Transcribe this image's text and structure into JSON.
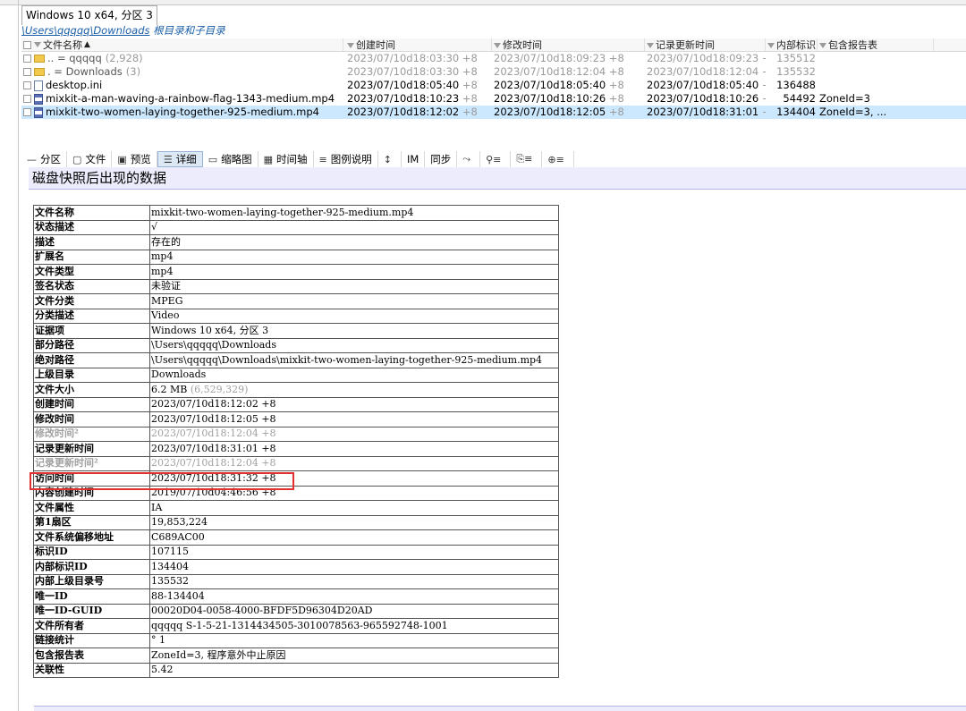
{
  "tab": {
    "label": "Windows 10 x64, 分区 3"
  },
  "path": {
    "main": "\\Users\\qqqqq\\Downloads",
    "suffix": " 根目录和子目录"
  },
  "columns": {
    "name": "文件名称",
    "created": "创建时间",
    "modified": "修改时间",
    "record": "记录更新时间",
    "internal": "内部标识",
    "report": "包含报告表"
  },
  "rows": [
    {
      "icon": "folder",
      "name": "..  =  qqqqq",
      "count": "(2,928)",
      "created": "2023/07/10d18:03:30",
      "modified": "2023/07/10d18:09:23",
      "record": "2023/07/10d18:09:23",
      "internal": "135512",
      "report": "",
      "tz": "+8",
      "dim": true,
      "selected": false
    },
    {
      "icon": "folder",
      "name": ".  =  Downloads",
      "count": "(3)",
      "created": "2023/07/10d18:03:30",
      "modified": "2023/07/10d18:12:04",
      "record": "2023/07/10d18:12:04",
      "internal": "135532",
      "report": "",
      "tz": "+8",
      "dim": true,
      "selected": false
    },
    {
      "icon": "file",
      "name": "desktop.ini",
      "count": "",
      "created": "2023/07/10d18:05:40",
      "modified": "2023/07/10d18:05:40",
      "record": "2023/07/10d18:05:40",
      "internal": "136488",
      "report": "",
      "tz": "+8",
      "dim": false,
      "selected": false
    },
    {
      "icon": "video",
      "name": "mixkit-a-man-waving-a-rainbow-flag-1343-medium.mp4",
      "count": "",
      "created": "2023/07/10d18:10:23",
      "modified": "2023/07/10d18:10:26",
      "record": "2023/07/10d18:10:26",
      "internal": "54492",
      "report": "ZoneId=3",
      "tz": "+8",
      "dim": false,
      "selected": false
    },
    {
      "icon": "video",
      "name": "mixkit-two-women-laying-together-925-medium.mp4",
      "count": "",
      "created": "2023/07/10d18:12:02",
      "modified": "2023/07/10d18:12:05",
      "record": "2023/07/10d18:31:01",
      "internal": "134404",
      "report": "ZoneId=3, ...",
      "tz": "+8",
      "dim": false,
      "selected": true
    }
  ],
  "toolbar": [
    {
      "icon": "minus-icon",
      "glyph": "—",
      "label": "分区"
    },
    {
      "icon": "file-icon",
      "glyph": "▢",
      "label": "文件"
    },
    {
      "icon": "preview-icon",
      "glyph": "▣",
      "label": "预览"
    },
    {
      "icon": "details-icon",
      "glyph": "☰",
      "label": "详细",
      "active": true
    },
    {
      "icon": "thumbnail-icon",
      "glyph": "▭",
      "label": "缩略图"
    },
    {
      "icon": "timeline-icon",
      "glyph": "▦",
      "label": "时间轴"
    },
    {
      "icon": "legend-icon",
      "glyph": "≡",
      "label": "图例说明"
    },
    {
      "icon": "sort-icon",
      "glyph": "↕",
      "label": ""
    },
    {
      "icon": "im-icon",
      "glyph": "",
      "label": "IM"
    },
    {
      "icon": "sync-icon",
      "glyph": "",
      "label": "同步"
    },
    {
      "icon": "link-icon",
      "glyph": "⤳",
      "label": ""
    },
    {
      "icon": "binoculars-icon",
      "glyph": "⚲≡",
      "label": ""
    },
    {
      "icon": "properties-icon",
      "glyph": "⎘≡",
      "label": ""
    },
    {
      "icon": "target-icon",
      "glyph": "⊕≡",
      "label": ""
    }
  ],
  "preview_title": "磁盘快照后出现的数据",
  "properties": [
    {
      "key": "文件名称",
      "value": "mixkit-two-women-laying-together-925-medium.mp4"
    },
    {
      "key": "状态描述",
      "value": "√"
    },
    {
      "key": "描述",
      "value": "存在的"
    },
    {
      "key": "扩展名",
      "value": "mp4"
    },
    {
      "key": "文件类型",
      "value": "mp4"
    },
    {
      "key": "签名状态",
      "value": "未验证"
    },
    {
      "key": "文件分类",
      "value": "MPEG"
    },
    {
      "key": "分类描述",
      "value": "Video"
    },
    {
      "key": "证据项",
      "value": "Windows 10 x64, 分区 3"
    },
    {
      "key": "部分路径",
      "value": "\\Users\\qqqqq\\Downloads"
    },
    {
      "key": "绝对路径",
      "value": "\\Users\\qqqqq\\Downloads\\mixkit-two-women-laying-together-925-medium.mp4"
    },
    {
      "key": "上级目录",
      "value": "Downloads"
    },
    {
      "key": "文件大小",
      "value": "6.2 MB",
      "paren": "(6,529,329)"
    },
    {
      "key": "创建时间",
      "value": "2023/07/10d18:12:02 +8"
    },
    {
      "key": "修改时间",
      "value": "2023/07/10d18:12:05 +8"
    },
    {
      "key": "修改时间²",
      "value": "2023/07/10d18:12:04 +8",
      "grey": true
    },
    {
      "key": "记录更新时间",
      "value": "2023/07/10d18:31:01 +8"
    },
    {
      "key": "记录更新时间²",
      "value": "2023/07/10d18:12:04 +8",
      "grey": true
    },
    {
      "key": "访问时间",
      "value": "2023/07/10d18:31:32 +8",
      "highlight": true
    },
    {
      "key": "内容创建时间",
      "value": "2019/07/10d04:46:56 +8"
    },
    {
      "key": "文件属性",
      "value": "IA"
    },
    {
      "key": "第1扇区",
      "value": "19,853,224"
    },
    {
      "key": "文件系统偏移地址",
      "value": "C689AC00"
    },
    {
      "key": "标识ID",
      "value": "107115"
    },
    {
      "key": "内部标识ID",
      "value": "134404"
    },
    {
      "key": "内部上级目录号",
      "value": "135532"
    },
    {
      "key": "唯一ID",
      "value": "88-134404"
    },
    {
      "key": "唯一ID-GUID",
      "value": "00020D04-0058-4000-BFDF5D96304D20AD"
    },
    {
      "key": "文件所有者",
      "value": "qqqqq S-1-5-21-1314434505-3010078563-965592748-1001"
    },
    {
      "key": "链接统计",
      "value": "° 1"
    },
    {
      "key": "包含报告表",
      "value": "ZoneId=3, 程序意外中止原因"
    },
    {
      "key": "关联性",
      "value": "5.42"
    }
  ],
  "colors": {
    "selected_row": "#cce8ff",
    "highlight_box": "#e03030",
    "preview_bg": "#ececfc"
  }
}
